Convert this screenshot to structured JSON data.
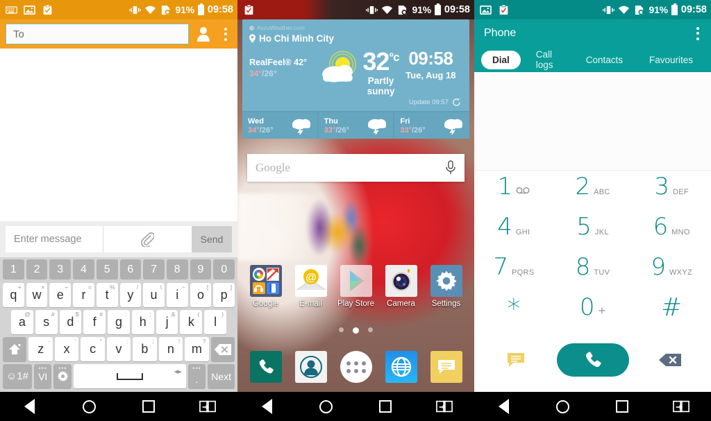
{
  "statusbar": {
    "battery": "91%",
    "time": "09:58",
    "icons_left_panel1": [
      "keyboard-icon",
      "image-icon",
      "clipboard-icon"
    ],
    "icons_left_panel2": [
      "clipboard-icon"
    ],
    "icons_left_panel3": [
      "image-icon",
      "clipboard-icon"
    ],
    "icons_right": [
      "vibrate-icon",
      "wifi-icon",
      "sim-icon"
    ]
  },
  "messaging": {
    "to_placeholder": "To",
    "compose_placeholder": "Enter message",
    "send_label": "Send",
    "keyboard": {
      "numbers": [
        "1",
        "2",
        "3",
        "4",
        "5",
        "6",
        "7",
        "8",
        "9",
        "0"
      ],
      "row1": [
        {
          "k": "q",
          "a": "+"
        },
        {
          "k": "w",
          "a": "×"
        },
        {
          "k": "e",
          "a": "÷"
        },
        {
          "k": "r",
          "a": "="
        },
        {
          "k": "t",
          "a": "%"
        },
        {
          "k": "y",
          "a": "/"
        },
        {
          "k": "u",
          "a": "\\"
        },
        {
          "k": "i",
          "a": "~"
        },
        {
          "k": "o",
          "a": "["
        },
        {
          "k": "p",
          "a": "]"
        }
      ],
      "row2": [
        {
          "k": "a",
          "a": "@"
        },
        {
          "k": "s",
          "a": "#"
        },
        {
          "k": "d",
          "a": "$"
        },
        {
          "k": "f",
          "a": "#"
        },
        {
          "k": "g",
          "a": ":"
        },
        {
          "k": "h",
          "a": ";"
        },
        {
          "k": "j",
          "a": "&"
        },
        {
          "k": "k",
          "a": "("
        },
        {
          "k": "l",
          "a": ")"
        }
      ],
      "row3": [
        {
          "k": "z",
          "a": "-"
        },
        {
          "k": "x",
          "a": "’"
        },
        {
          "k": "c",
          "a": "\""
        },
        {
          "k": "v",
          "a": ":"
        },
        {
          "k": "b",
          "a": ";"
        },
        {
          "k": "n",
          "a": "!"
        },
        {
          "k": "m",
          "a": "?"
        }
      ],
      "shift_label": "shift-key",
      "backspace_label": "backspace-key",
      "symbols_label": "☺1#",
      "language_label": "VI",
      "settings_label": "settings-key",
      "space_label": "space-key",
      "period_label": ".",
      "next_label": "Next"
    }
  },
  "home": {
    "weather": {
      "source": "AccuWeather.com",
      "city": "Ho Chi Minh City",
      "realfeel_label": "RealFeel®",
      "realfeel_value": "42°",
      "high": "34°",
      "low": "26°",
      "temperature": "32",
      "temp_unit": "°c",
      "condition": "Partly sunny",
      "clock": "09:58",
      "date": "Tue, Aug 18",
      "update": "Update 09:57",
      "forecast": [
        {
          "day": "Wed",
          "high": "34°",
          "low": "26°",
          "icon": "thunderstorm-icon"
        },
        {
          "day": "Thu",
          "high": "33°",
          "low": "26°",
          "icon": "thunderstorm-icon"
        },
        {
          "day": "Fri",
          "high": "33°",
          "low": "26°",
          "icon": "thunderstorm-icon"
        }
      ]
    },
    "search_placeholder": "Google",
    "apps": [
      {
        "label": "Google",
        "icon": "google-folder-icon"
      },
      {
        "label": "E-mail",
        "icon": "email-icon"
      },
      {
        "label": "Play Store",
        "icon": "play-store-icon"
      },
      {
        "label": "Camera",
        "icon": "camera-icon"
      },
      {
        "label": "Settings",
        "icon": "settings-gear-icon"
      }
    ],
    "pages": {
      "count": 3,
      "active": 2
    },
    "dock": [
      {
        "icon": "phone-icon"
      },
      {
        "icon": "contacts-icon"
      },
      {
        "icon": "app-drawer-icon"
      },
      {
        "icon": "browser-globe-icon"
      },
      {
        "icon": "messaging-icon"
      }
    ]
  },
  "phone": {
    "title": "Phone",
    "tabs": [
      {
        "label": "Dial",
        "active": true
      },
      {
        "label": "Call logs",
        "active": false
      },
      {
        "label": "Contacts",
        "active": false
      },
      {
        "label": "Favourites",
        "active": false
      }
    ],
    "keys": [
      [
        {
          "num": "1",
          "sub": "",
          "icon": "voicemail-icon"
        },
        {
          "num": "2",
          "sub": "ABC"
        },
        {
          "num": "3",
          "sub": "DEF"
        }
      ],
      [
        {
          "num": "4",
          "sub": "GHI"
        },
        {
          "num": "5",
          "sub": "JKL"
        },
        {
          "num": "6",
          "sub": "MNO"
        }
      ],
      [
        {
          "num": "7",
          "sub": "PQRS"
        },
        {
          "num": "8",
          "sub": "TUV"
        },
        {
          "num": "9",
          "sub": "WXYZ"
        }
      ],
      [
        {
          "num": "*",
          "sub": ""
        },
        {
          "num": "0",
          "sub": "+"
        },
        {
          "num": "#",
          "sub": ""
        }
      ]
    ],
    "actions": {
      "message_icon": "message-icon",
      "call_icon": "call-icon",
      "backspace_icon": "backspace-icon"
    }
  },
  "navbar": {
    "back": "back-button",
    "home": "home-button",
    "recents": "recents-button",
    "screenshot": "screenshot-button"
  },
  "colors": {
    "orange": "#f5a01e",
    "teal": "#0a9e9a",
    "weather_blue": "#74b2cb",
    "dial_teal": "#0f8a88"
  }
}
